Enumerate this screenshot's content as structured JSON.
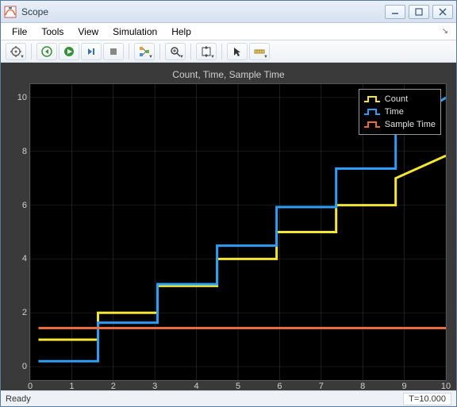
{
  "window": {
    "title": "Scope"
  },
  "menu": {
    "file": "File",
    "tools": "Tools",
    "view": "View",
    "simulation": "Simulation",
    "help": "Help"
  },
  "toolbar": {
    "gear": "settings",
    "run": "run",
    "step_fwd": "step-forward",
    "stepper": "step",
    "stop": "stop",
    "signals": "signals",
    "zoom": "zoom",
    "autoscale": "autoscale",
    "cursor": "cursor",
    "highlight": "highlight"
  },
  "status": {
    "ready": "Ready",
    "time": "T=10.000"
  },
  "chart_data": {
    "type": "line",
    "title": "Count, Time, Sample Time",
    "xlabel": "",
    "ylabel": "",
    "xlim": [
      0,
      10
    ],
    "ylim": [
      -0.5,
      10.5
    ],
    "x_ticks": [
      0,
      1,
      2,
      3,
      4,
      5,
      6,
      7,
      8,
      9,
      10
    ],
    "y_ticks": [
      0,
      2,
      4,
      6,
      8,
      10
    ],
    "grid": true,
    "legend_position": "top-right",
    "series": [
      {
        "name": "Count",
        "color": "#f5e633",
        "x": [
          0.2,
          1.632,
          1.632,
          3.064,
          3.064,
          4.496,
          4.496,
          5.928,
          5.928,
          7.36,
          7.36,
          8.792,
          8.792,
          10
        ],
        "y": [
          1,
          1,
          2,
          2,
          3,
          3,
          4,
          4,
          5,
          5,
          6,
          6,
          7,
          7.84
        ]
      },
      {
        "name": "Time",
        "color": "#2e9df7",
        "x": [
          0.2,
          1.632,
          1.632,
          3.064,
          3.064,
          4.496,
          4.496,
          5.928,
          5.928,
          7.36,
          7.36,
          8.792,
          8.792,
          10
        ],
        "y": [
          0.2,
          0.2,
          1.632,
          1.632,
          3.064,
          3.064,
          4.496,
          4.496,
          5.928,
          5.928,
          7.36,
          7.36,
          8.792,
          10.0
        ]
      },
      {
        "name": "Sample Time",
        "color": "#e86d3a",
        "x": [
          0.2,
          10
        ],
        "y": [
          1.432,
          1.432
        ]
      }
    ]
  }
}
